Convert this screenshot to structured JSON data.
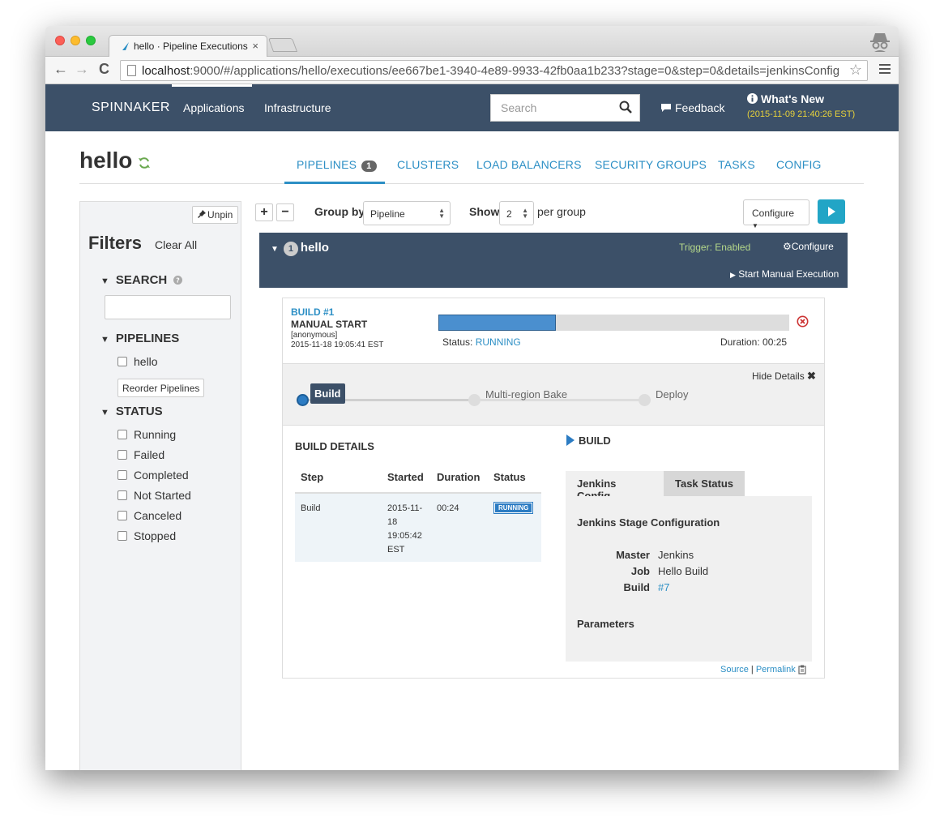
{
  "browser": {
    "tab_title": "hello · Pipeline Executions",
    "tab_close": "×",
    "url_host": "localhost",
    "url_rest": ":9000/#/applications/hello/executions/ee667be1-3940-4e89-9933-42fb0aa1b233?stage=0&step=0&details=jenkinsConfig",
    "back": "←",
    "forward": "→",
    "reload": "C",
    "star": "☆"
  },
  "header": {
    "brand": "SPINNAKER",
    "nav": [
      "Applications",
      "Infrastructure"
    ],
    "search_placeholder": "Search",
    "feedback": "Feedback",
    "whats_new": "What's New",
    "whats_new_date": "(2015-11-09 21:40:26 EST)"
  },
  "app": {
    "name": "hello",
    "tabs": [
      "PIPELINES",
      "CLUSTERS",
      "LOAD BALANCERS",
      "SECURITY GROUPS",
      "TASKS",
      "CONFIG"
    ],
    "pipelines_count": "1"
  },
  "filters": {
    "unpin": "Unpin",
    "title": "Filters",
    "clear_all": "Clear All",
    "search_heading": "SEARCH",
    "pipelines_heading": "PIPELINES",
    "pipelines": [
      "hello"
    ],
    "reorder": "Reorder Pipelines",
    "status_heading": "STATUS",
    "statuses": [
      "Running",
      "Failed",
      "Completed",
      "Not Started",
      "Canceled",
      "Stopped"
    ]
  },
  "toolbar": {
    "expand": "+",
    "collapse": "−",
    "group_by_label": "Group by",
    "group_by_value": "Pipeline",
    "show_label": "Show",
    "show_value": "2",
    "per_group": "per group",
    "configure": "Configure"
  },
  "pipeline": {
    "count": "1",
    "name": "hello",
    "trigger": "Trigger: Enabled",
    "configure": "Configure",
    "start_manual": "Start Manual Execution"
  },
  "execution": {
    "build_link": "BUILD #1",
    "trigger": "MANUAL START",
    "user": "[anonymous]",
    "time": "2015-11-18 19:05:41 EST",
    "progress_fraction": 0.335,
    "status_label": "Status:",
    "status_value": "RUNNING",
    "duration": "Duration: 00:25",
    "hide_details": "Hide Details",
    "stages": [
      "Build",
      "Multi-region Bake",
      "Deploy"
    ]
  },
  "build_details": {
    "title": "BUILD DETAILS",
    "columns": [
      "Step",
      "Started",
      "Duration",
      "Status"
    ],
    "rows": [
      {
        "step": "Build",
        "started_lines": [
          "2015-11-",
          "18",
          "19:05:42",
          "EST"
        ],
        "duration": "00:24",
        "status": "RUNNING"
      }
    ]
  },
  "build_panel": {
    "heading": "BUILD",
    "tabs": [
      "Jenkins Config",
      "Task Status"
    ],
    "config_title": "Jenkins Stage Configuration",
    "master_key": "Master",
    "master_val": "Jenkins",
    "job_key": "Job",
    "job_val": "Hello Build",
    "build_key": "Build",
    "build_val": "#7",
    "params_title": "Parameters",
    "source": "Source",
    "sep": "|",
    "permalink": "Permalink"
  },
  "colors": {
    "header_bg": "#3c5068",
    "accent": "#2c8fc5",
    "running": "#2c7cc3",
    "play_button": "#22a5c6",
    "trigger_enabled": "#b5d88a",
    "whats_new_date": "#e8d23a"
  }
}
